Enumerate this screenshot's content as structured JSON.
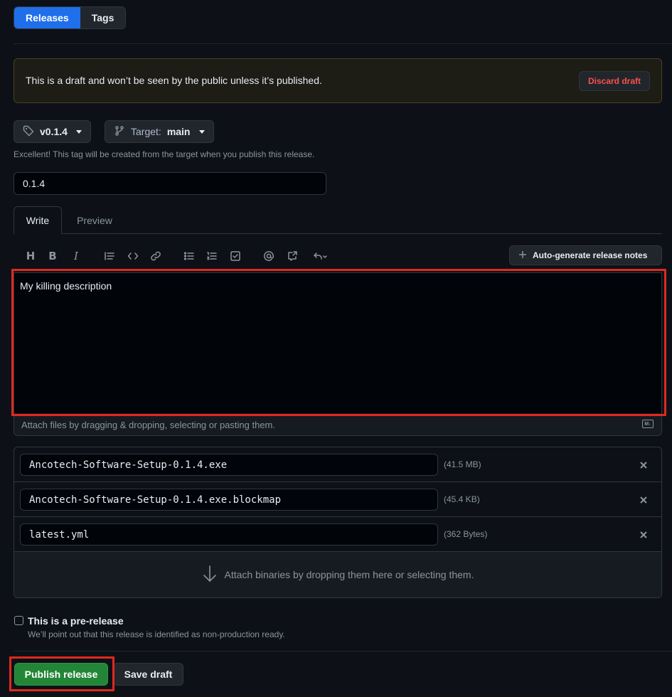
{
  "tabs": {
    "releases": "Releases",
    "tags": "Tags"
  },
  "flash": {
    "text": "This is a draft and won’t be seen by the public unless it’s published.",
    "discard_label": "Discard draft"
  },
  "tag_selector": {
    "value": "v0.1.4"
  },
  "target_selector": {
    "label": "Target:",
    "value": "main"
  },
  "tag_hint": "Excellent! This tag will be created from the target when you publish this release.",
  "title_input": {
    "value": "0.1.4"
  },
  "editor_tabs": {
    "write": "Write",
    "preview": "Preview"
  },
  "toolbar": {
    "heading_glyph": "H",
    "bold_glyph": "B",
    "italic_glyph": "I",
    "autogen_label": "Auto-generate release notes"
  },
  "description": {
    "value": "My killing description"
  },
  "attach_hint": "Attach files by dragging & dropping, selecting or pasting them.",
  "markdown_badge": "M↓",
  "assets": [
    {
      "name": "Ancotech-Software-Setup-0.1.4.exe",
      "size": "(41.5 MB)"
    },
    {
      "name": "Ancotech-Software-Setup-0.1.4.exe.blockmap",
      "size": "(45.4 KB)"
    },
    {
      "name": "latest.yml",
      "size": "(362 Bytes)"
    }
  ],
  "dropzone_text": "Attach binaries by dropping them here or selecting them.",
  "prerelease": {
    "title": "This is a pre-release",
    "description": "We’ll point out that this release is identified as non-production ready.",
    "checked": false
  },
  "footer": {
    "publish_label": "Publish release",
    "save_label": "Save draft"
  },
  "colors": {
    "highlight": "#e0291f",
    "primary": "#238636",
    "accent": "#1f6feb",
    "danger": "#f85149"
  }
}
